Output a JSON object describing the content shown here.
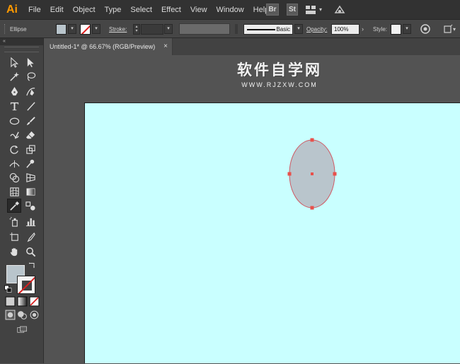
{
  "app": {
    "logo": "Ai"
  },
  "menu": [
    "File",
    "Edit",
    "Object",
    "Type",
    "Select",
    "Effect",
    "View",
    "Window",
    "Help"
  ],
  "app_buttons": {
    "bridge": "Br",
    "stock": "St"
  },
  "control_bar": {
    "selection_type": "Ellipse",
    "stroke_label": "Stroke:",
    "brush_label": "Basic",
    "opacity_label": "Opacity:",
    "opacity_value": "100%",
    "style_label": "Style:"
  },
  "document_tab": {
    "title": "Untitled-1* @ 66.67% (RGB/Preview)",
    "close": "×"
  },
  "toolbox": {
    "collapse": "«"
  },
  "watermark": {
    "title": "软件自学网",
    "url": "WWW.RJZXW.COM"
  },
  "colors": {
    "fill": "#b9c5cc",
    "artboard_bg": "#c9ffff",
    "selection_anchor": "#e8504a",
    "ellipse_stroke": "#d05a64"
  }
}
